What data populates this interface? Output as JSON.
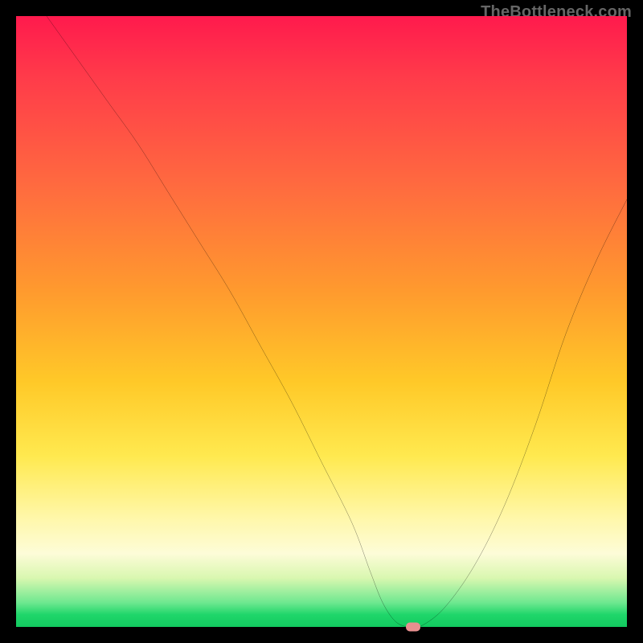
{
  "watermark": "TheBottleneck.com",
  "chart_data": {
    "type": "line",
    "title": "",
    "xlabel": "",
    "ylabel": "",
    "xlim": [
      0,
      100
    ],
    "ylim": [
      0,
      100
    ],
    "grid": false,
    "series": [
      {
        "name": "bottleneck-curve",
        "x": [
          5,
          10,
          15,
          20,
          25,
          30,
          35,
          40,
          45,
          50,
          55,
          58,
          60,
          62,
          64,
          66,
          70,
          75,
          80,
          85,
          90,
          95,
          100
        ],
        "values": [
          100,
          93,
          86,
          79,
          71,
          63,
          55,
          46,
          37,
          27,
          17,
          9,
          4,
          1,
          0,
          0,
          3,
          10,
          20,
          33,
          48,
          60,
          70
        ]
      }
    ],
    "marker": {
      "x": 65,
      "y": 0,
      "color": "#e88f8f"
    },
    "background_gradient": {
      "stops": [
        {
          "pos": 0.0,
          "color": "#ff1a4d"
        },
        {
          "pos": 0.45,
          "color": "#ff9a2e"
        },
        {
          "pos": 0.72,
          "color": "#ffe94f"
        },
        {
          "pos": 0.92,
          "color": "#d9f7b0"
        },
        {
          "pos": 1.0,
          "color": "#12c95f"
        }
      ]
    }
  }
}
